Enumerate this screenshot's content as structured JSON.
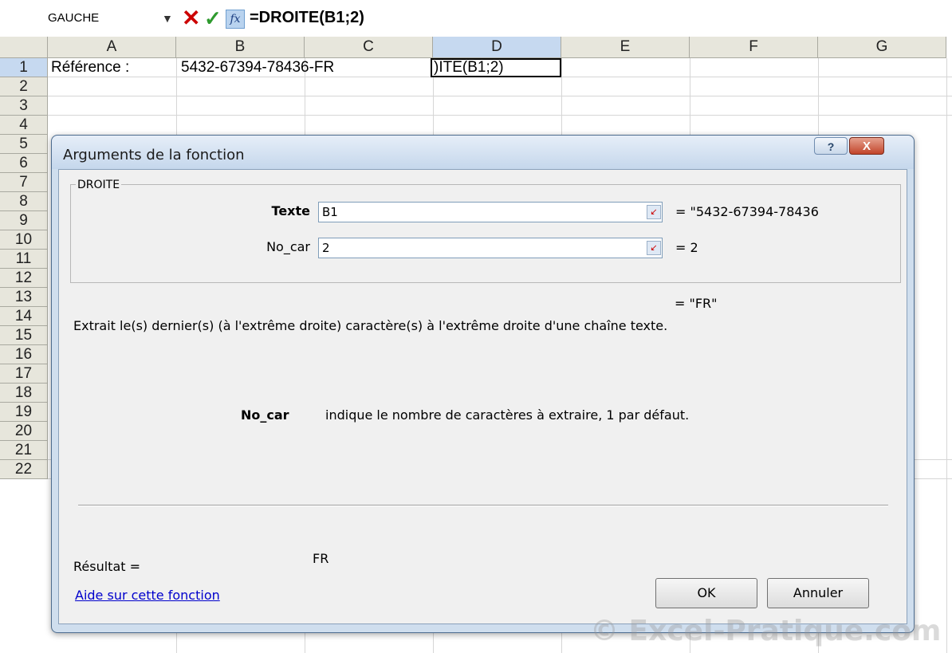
{
  "formula_bar": {
    "name_box": "GAUCHE",
    "dropdown_icon": "▼",
    "cancel_icon": "✕",
    "enter_icon": "✓",
    "fx_icon": "fx",
    "formula": "=DROITE(B1;2)"
  },
  "sheet": {
    "columns": [
      "A",
      "B",
      "C",
      "D",
      "E",
      "F",
      "G"
    ],
    "rows": [
      "1",
      "2",
      "3",
      "4",
      "5",
      "6",
      "7",
      "8",
      "9",
      "10",
      "11",
      "12",
      "13",
      "14",
      "15",
      "16",
      "17",
      "18",
      "19",
      "20",
      "21",
      "22"
    ],
    "cells": {
      "A1": "Référence :",
      "B1": "5432-67394-78436-FR",
      "D1": ")ITE(B1;2)"
    },
    "selected_cell": "D1"
  },
  "dialog": {
    "title": "Arguments de la fonction",
    "help_icon": "?",
    "close_icon": "X",
    "function_name": "DROITE",
    "args": [
      {
        "label": "Texte",
        "value": "B1",
        "result": "= \"5432-67394-78436"
      },
      {
        "label": "No_car",
        "value": "2",
        "result": "= 2"
      }
    ],
    "function_result": "= \"FR\"",
    "description": "Extrait le(s) dernier(s) (à l'extrême droite) caractère(s) à l'extrême droite d'une chaîne texte.",
    "arg_help_name": "No_car",
    "arg_help_text": "indique le nombre de caractères à extraire, 1 par défaut.",
    "result_label": "Résultat =",
    "result_value": "FR",
    "help_link": "Aide sur cette fonction",
    "ok_label": "OK",
    "cancel_label": "Annuler"
  },
  "watermark": "© Excel-Pratique.com",
  "colors": {
    "cancel": "#cc0000",
    "enter": "#2e9a2e",
    "selection_header": "#c6d9f0",
    "dialog_frame": "#cfdeee"
  }
}
